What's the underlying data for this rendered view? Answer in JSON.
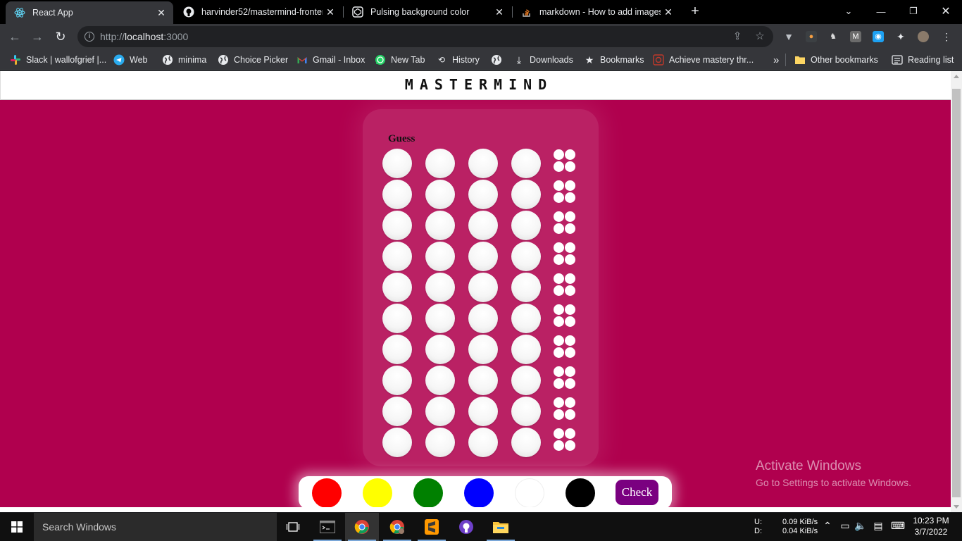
{
  "browser": {
    "tabs": [
      {
        "title": "React App",
        "icon": "react-icon",
        "active": true
      },
      {
        "title": "harvinder52/mastermind-fronten",
        "icon": "github-icon",
        "active": false
      },
      {
        "title": "Pulsing background color",
        "icon": "codepen-icon",
        "active": false
      },
      {
        "title": "markdown - How to add images",
        "icon": "stackoverflow-icon",
        "active": false
      }
    ],
    "url_scheme": "http://",
    "url_host": "localhost",
    "url_port": ":3000",
    "bookmarks": [
      {
        "label": "Slack | wallofgrief |...",
        "icon": "slack-icon"
      },
      {
        "label": "Web",
        "icon": "telegram-icon"
      },
      {
        "label": "minima",
        "icon": "globe-icon"
      },
      {
        "label": "Choice Picker",
        "icon": "globe-icon"
      },
      {
        "label": "Gmail - Inbox",
        "icon": "gmail-icon"
      },
      {
        "label": "New Tab",
        "icon": "whatsapp-icon"
      },
      {
        "label": "History",
        "icon": "history-icon"
      },
      {
        "label": "",
        "icon": "globe-icon"
      },
      {
        "label": "Downloads",
        "icon": "download-icon"
      },
      {
        "label": "Bookmarks",
        "icon": "star-icon"
      },
      {
        "label": "Achieve mastery thr...",
        "icon": "brain-icon"
      }
    ],
    "overflow": "»",
    "other_bookmarks": "Other bookmarks",
    "reading_list": "Reading list"
  },
  "app": {
    "title": "MASTERMIND",
    "guess_label": "Guess",
    "rows": 10,
    "pegs_per_row": 4,
    "palette": [
      {
        "name": "red",
        "color": "#ff0000"
      },
      {
        "name": "yellow",
        "color": "#ffff00"
      },
      {
        "name": "green",
        "color": "#008000"
      },
      {
        "name": "blue",
        "color": "#0000ff"
      },
      {
        "name": "white",
        "color": "#ffffff"
      },
      {
        "name": "black",
        "color": "#000000"
      }
    ],
    "check_label": "Check",
    "colors": {
      "background": "#b0004e",
      "check_button": "#7a0080"
    }
  },
  "watermark": {
    "line1": "Activate Windows",
    "line2": "Go to Settings to activate Windows."
  },
  "taskbar": {
    "search_placeholder": "Search Windows",
    "net_up_label": "U:",
    "net_down_label": "D:",
    "net_up": "0.09 KiB/s",
    "net_down": "0.04 KiB/s",
    "time": "10:23 PM",
    "date": "3/7/2022"
  }
}
